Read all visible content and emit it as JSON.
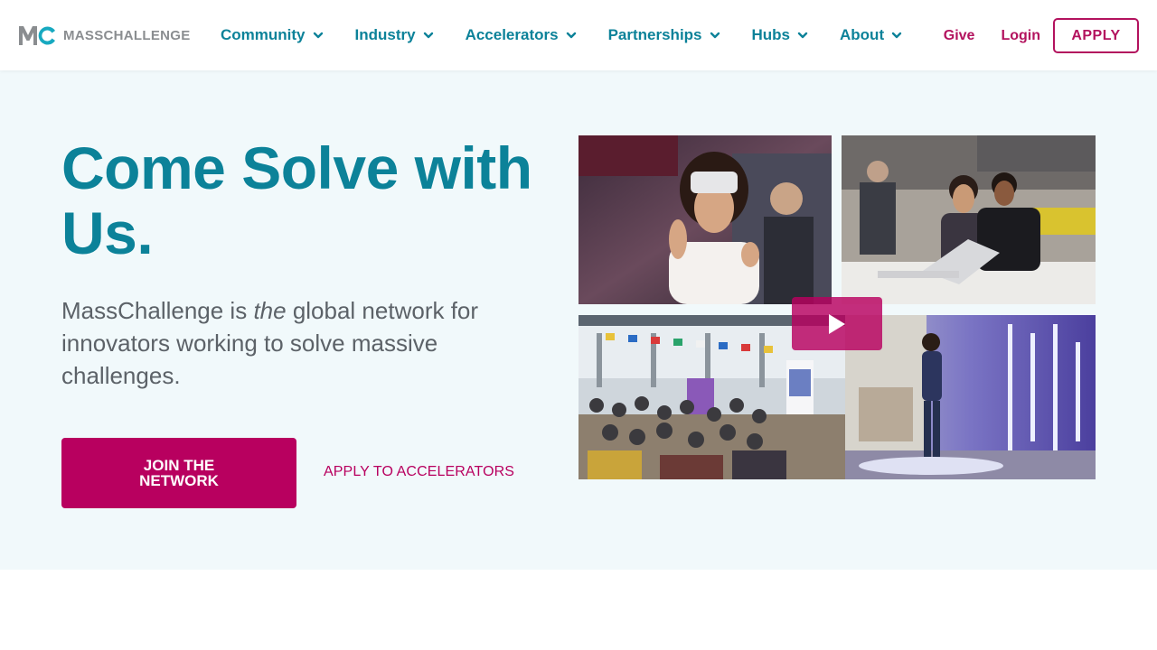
{
  "brand": {
    "logo_text": "MASSCHALLENGE",
    "colors": {
      "teal": "#0c8299",
      "magenta": "#b8005f",
      "hero_bg": "#f1f9fb",
      "text_gray": "#5c6268"
    }
  },
  "nav": {
    "items": [
      {
        "label": "Community"
      },
      {
        "label": "Industry"
      },
      {
        "label": "Accelerators"
      },
      {
        "label": "Partnerships"
      },
      {
        "label": "Hubs"
      },
      {
        "label": "About"
      }
    ],
    "give_label": "Give",
    "login_label": "Login",
    "apply_label": "APPLY"
  },
  "hero": {
    "title": "Come Solve with Us.",
    "subtitle_prefix": "MassChallenge is ",
    "subtitle_emphasis": "the",
    "subtitle_suffix": " global network for innovators working to solve massive challenges.",
    "join_label": "JOIN THE NETWORK",
    "apply_accelerators_label": "APPLY TO ACCELERATORS"
  },
  "media": {
    "play_icon": "play-icon",
    "photos": [
      "vr-headset-photo",
      "laptop-demo-photo",
      "audience-event-photo",
      "stage-speaker-photo"
    ]
  }
}
